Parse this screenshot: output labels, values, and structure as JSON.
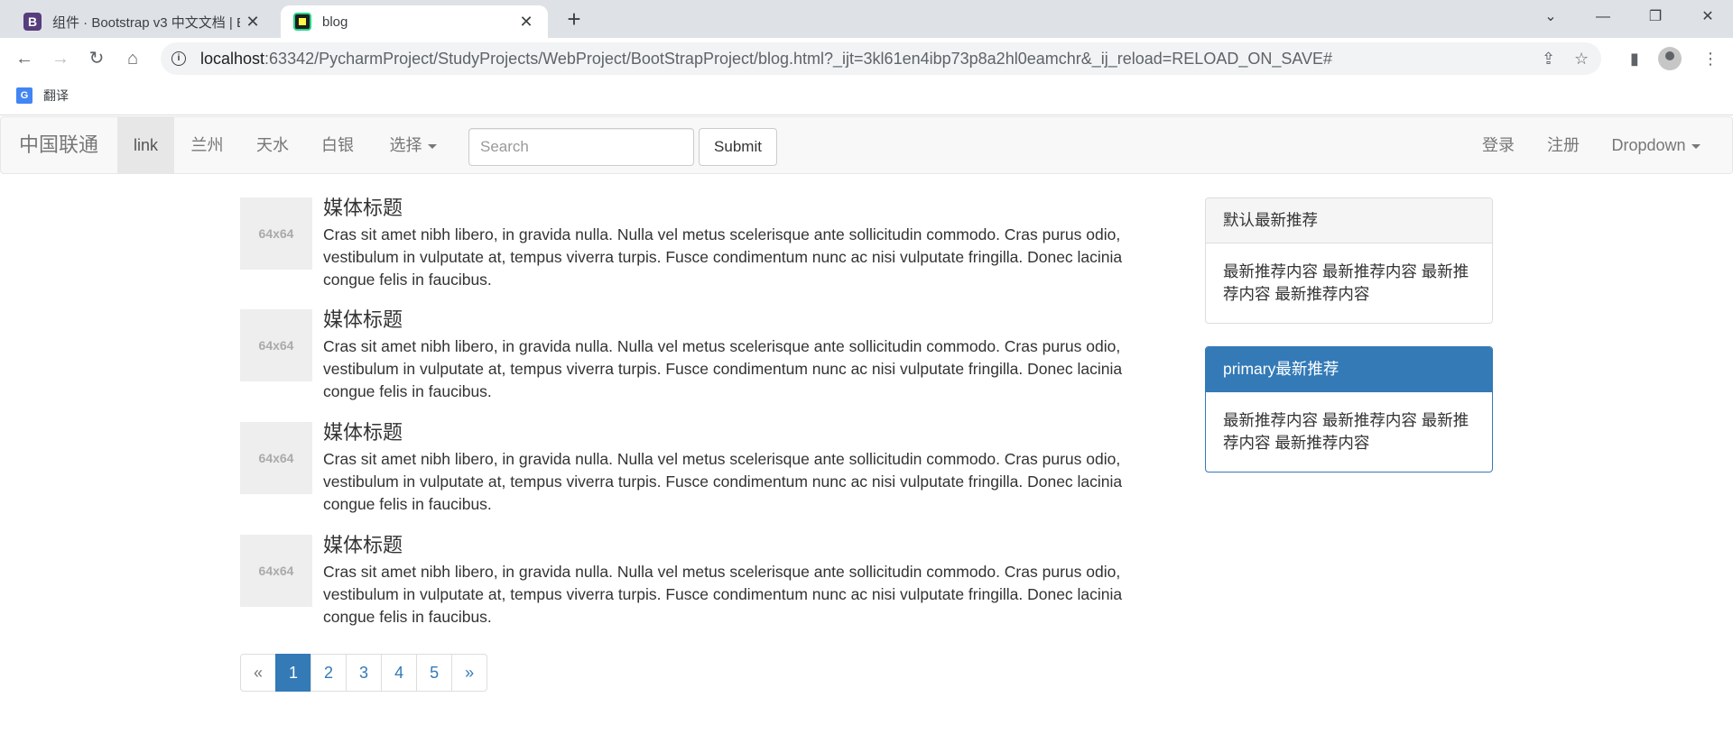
{
  "browser": {
    "tabs": [
      {
        "title": "组件 · Bootstrap v3 中文文档 | B",
        "favicon": "B",
        "active": false
      },
      {
        "title": "blog",
        "active": true
      }
    ],
    "new_tab": "+",
    "url_host": "localhost",
    "url_rest": ":63342/PycharmProject/StudyProjects/WebProject/BootStrapProject/blog.html?_ijt=3kl61en4ibp73p8a2hl0eamchr&_ij_reload=RELOAD_ON_SAVE#",
    "bookmarks": [
      {
        "label": "翻译",
        "icon": "google-translate-icon"
      }
    ]
  },
  "navbar": {
    "brand": "中国联通",
    "left_links": [
      {
        "label": "link",
        "active": true
      },
      {
        "label": "兰州"
      },
      {
        "label": "天水"
      },
      {
        "label": "白银"
      },
      {
        "label": "选择",
        "dropdown": true
      }
    ],
    "search_placeholder": "Search",
    "submit_label": "Submit",
    "right_links": [
      {
        "label": "登录"
      },
      {
        "label": "注册"
      },
      {
        "label": "Dropdown",
        "dropdown": true
      }
    ]
  },
  "media_list": [
    {
      "thumb": "64x64",
      "heading": "媒体标题",
      "text": "Cras sit amet nibh libero, in gravida nulla. Nulla vel metus scelerisque ante sollicitudin commodo. Cras purus odio, vestibulum in vulputate at, tempus viverra turpis. Fusce condimentum nunc ac nisi vulputate fringilla. Donec lacinia congue felis in faucibus."
    },
    {
      "thumb": "64x64",
      "heading": "媒体标题",
      "text": "Cras sit amet nibh libero, in gravida nulla. Nulla vel metus scelerisque ante sollicitudin commodo. Cras purus odio, vestibulum in vulputate at, tempus viverra turpis. Fusce condimentum nunc ac nisi vulputate fringilla. Donec lacinia congue felis in faucibus."
    },
    {
      "thumb": "64x64",
      "heading": "媒体标题",
      "text": "Cras sit amet nibh libero, in gravida nulla. Nulla vel metus scelerisque ante sollicitudin commodo. Cras purus odio, vestibulum in vulputate at, tempus viverra turpis. Fusce condimentum nunc ac nisi vulputate fringilla. Donec lacinia congue felis in faucibus."
    },
    {
      "thumb": "64x64",
      "heading": "媒体标题",
      "text": "Cras sit amet nibh libero, in gravida nulla. Nulla vel metus scelerisque ante sollicitudin commodo. Cras purus odio, vestibulum in vulputate at, tempus viverra turpis. Fusce condimentum nunc ac nisi vulputate fringilla. Donec lacinia congue felis in faucibus."
    }
  ],
  "pagination": {
    "prev": "«",
    "pages": [
      "1",
      "2",
      "3",
      "4",
      "5"
    ],
    "active_page": "1",
    "next": "»"
  },
  "panels": [
    {
      "style": "default",
      "heading": "默认最新推荐",
      "body": "最新推荐内容 最新推荐内容 最新推荐内容 最新推荐内容"
    },
    {
      "style": "primary",
      "heading": "primary最新推荐",
      "body": "最新推荐内容 最新推荐内容 最新推荐内容 最新推荐内容"
    }
  ],
  "colors": {
    "primary": "#337ab7",
    "navbar_bg": "#f8f8f8",
    "thumb_bg": "#eeeeee"
  }
}
